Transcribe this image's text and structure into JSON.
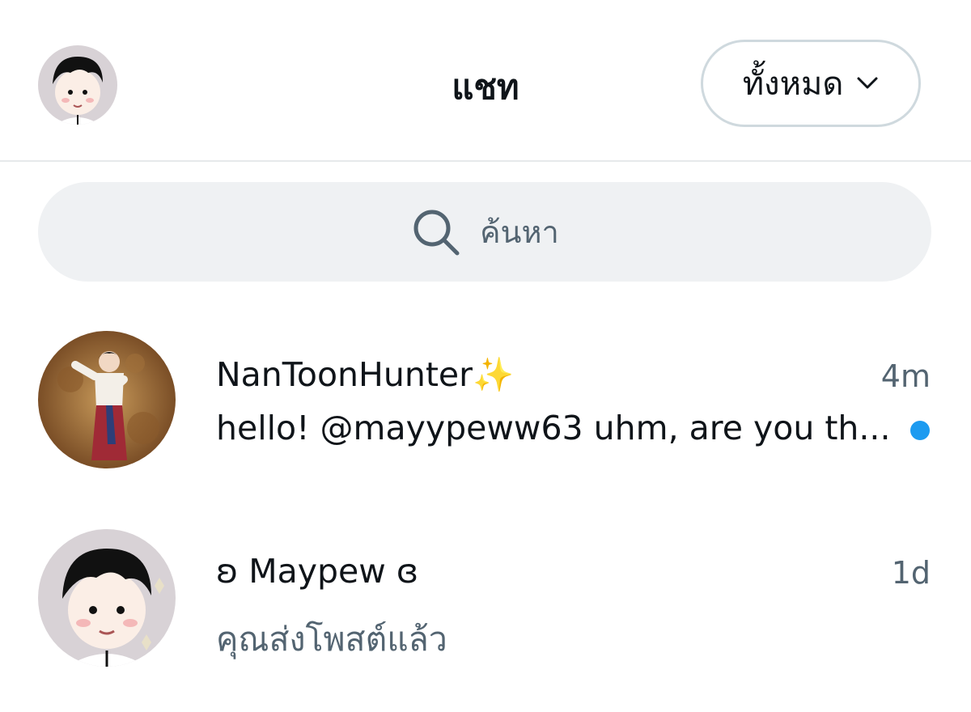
{
  "header": {
    "title": "แชท",
    "filter_label": "ทั้งหมด"
  },
  "search": {
    "placeholder": "ค้นหา"
  },
  "conversations": [
    {
      "name": "NanToonHunter✨",
      "time": "4m",
      "preview": "hello! @mayypeww63 uhm, are you th...",
      "unread": true
    },
    {
      "name": "ʚ Maypew ɞ",
      "time": "1d",
      "preview": "คุณส่งโพสต์แล้ว",
      "unread": false
    }
  ],
  "colors": {
    "accent": "#1d9bf0",
    "secondary_text": "#536471",
    "primary_text": "#0f1419",
    "search_bg": "#eff1f3",
    "divider": "#e6e9eb"
  },
  "icons": {
    "search": "search-icon",
    "filter_chevron": "chevron-down-icon"
  }
}
